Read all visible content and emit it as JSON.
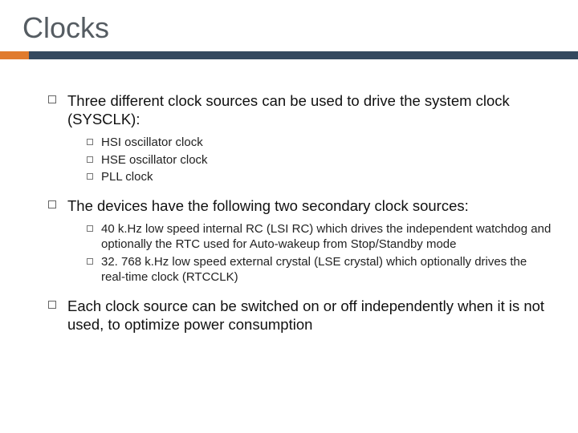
{
  "title": "Clocks",
  "bullets": [
    {
      "text": "Three different clock sources can be used to drive the system clock (SYSCLK):",
      "subs": [
        "HSI oscillator clock",
        "HSE oscillator clock",
        "PLL clock"
      ]
    },
    {
      "text": "The devices have the following two secondary clock sources:",
      "subs": [
        "40 k.Hz low speed internal RC (LSI RC) which drives the independent watchdog and optionally the RTC used for Auto-wakeup from Stop/Standby mode",
        "32. 768 k.Hz low speed external crystal (LSE crystal) which optionally drives the real-time clock (RTCCLK)"
      ]
    },
    {
      "text": "Each clock source can be switched on or off independently when it is not used, to optimize power consumption",
      "subs": []
    }
  ]
}
